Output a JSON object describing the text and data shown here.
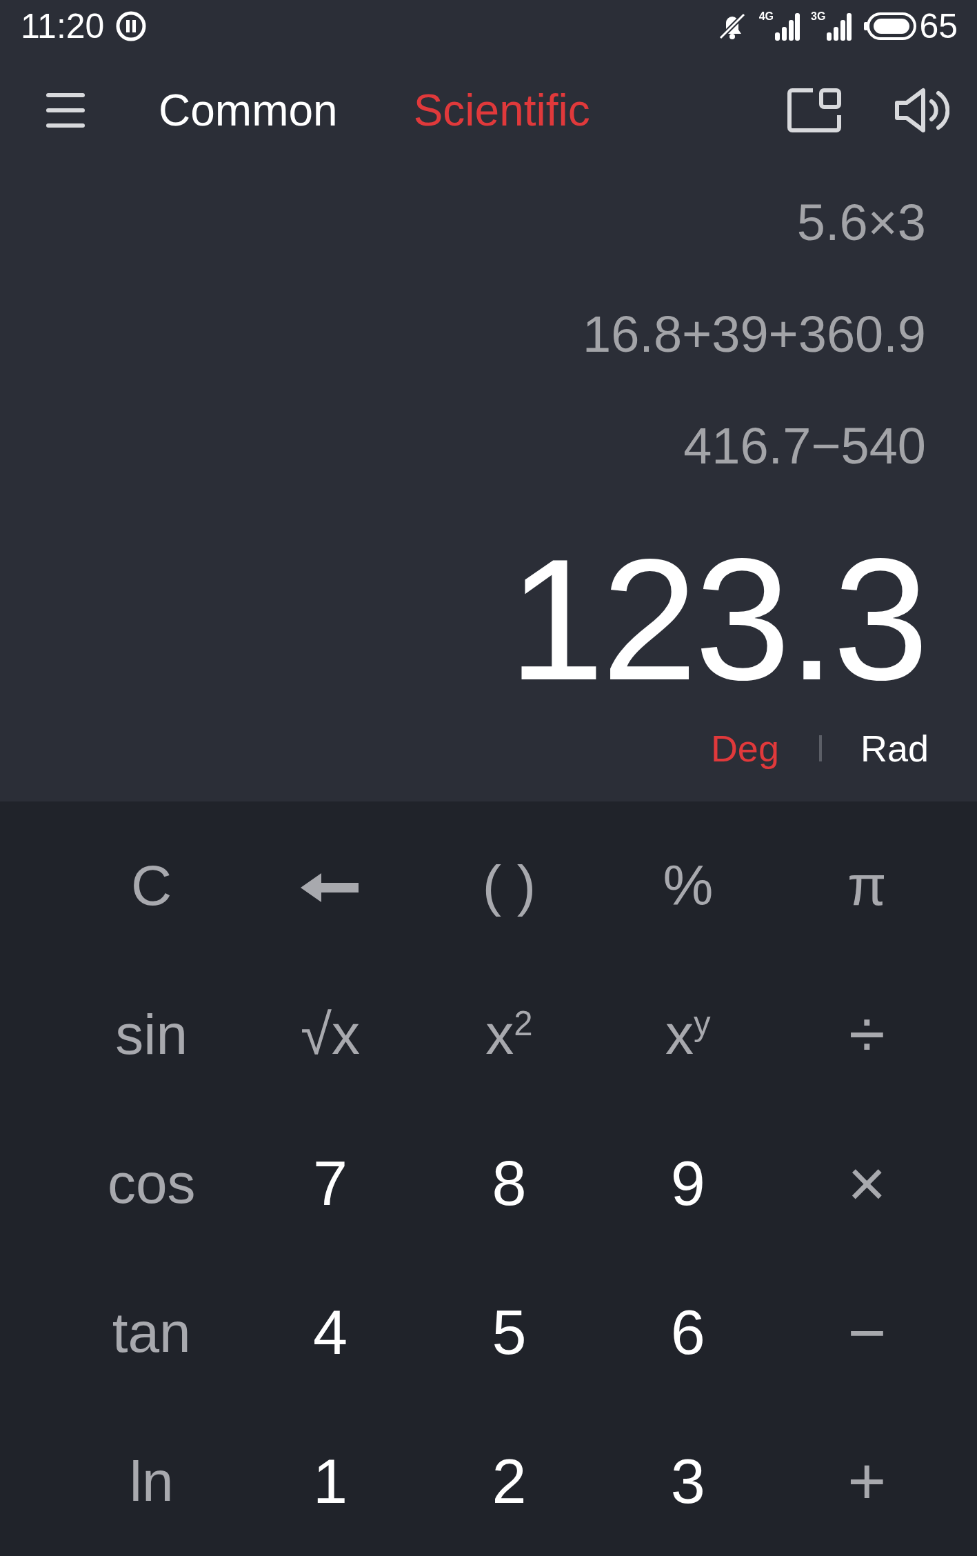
{
  "status_bar": {
    "time": "11:20",
    "networks": [
      "4G",
      "3G"
    ],
    "battery": "65"
  },
  "tabs": [
    {
      "label": "Common",
      "selected": false
    },
    {
      "label": "Scientific",
      "selected": true
    }
  ],
  "history": [
    "5.6×3",
    "16.8+39+360.9",
    "416.7−540"
  ],
  "result": "123.3",
  "angle_modes": [
    {
      "label": "Deg",
      "selected": true
    },
    {
      "label": "Rad",
      "selected": false
    }
  ],
  "keypad": [
    [
      {
        "kind": "function",
        "label": "C"
      },
      {
        "kind": "backspace"
      },
      {
        "kind": "function",
        "label": "( )"
      },
      {
        "kind": "function",
        "label": "%"
      },
      {
        "kind": "function",
        "label": "π"
      }
    ],
    [
      {
        "kind": "function",
        "label": "sin"
      },
      {
        "kind": "function",
        "label": "√x"
      },
      {
        "kind": "function",
        "label": "x$^{2}$"
      },
      {
        "kind": "function",
        "label": "x$^{y}$"
      },
      {
        "kind": "operator",
        "label": "÷"
      }
    ],
    [
      {
        "kind": "function",
        "label": "cos"
      },
      {
        "kind": "digit",
        "label": "7"
      },
      {
        "kind": "digit",
        "label": "8"
      },
      {
        "kind": "digit",
        "label": "9"
      },
      {
        "kind": "operator",
        "label": "×"
      }
    ],
    [
      {
        "kind": "function",
        "label": "tan"
      },
      {
        "kind": "digit",
        "label": "4"
      },
      {
        "kind": "digit",
        "label": "5"
      },
      {
        "kind": "digit",
        "label": "6"
      },
      {
        "kind": "operator",
        "label": "−"
      }
    ],
    [
      {
        "kind": "function",
        "label": "ln"
      },
      {
        "kind": "digit",
        "label": "1"
      },
      {
        "kind": "digit",
        "label": "2"
      },
      {
        "kind": "digit",
        "label": "3"
      },
      {
        "kind": "operator",
        "label": "+"
      }
    ]
  ]
}
